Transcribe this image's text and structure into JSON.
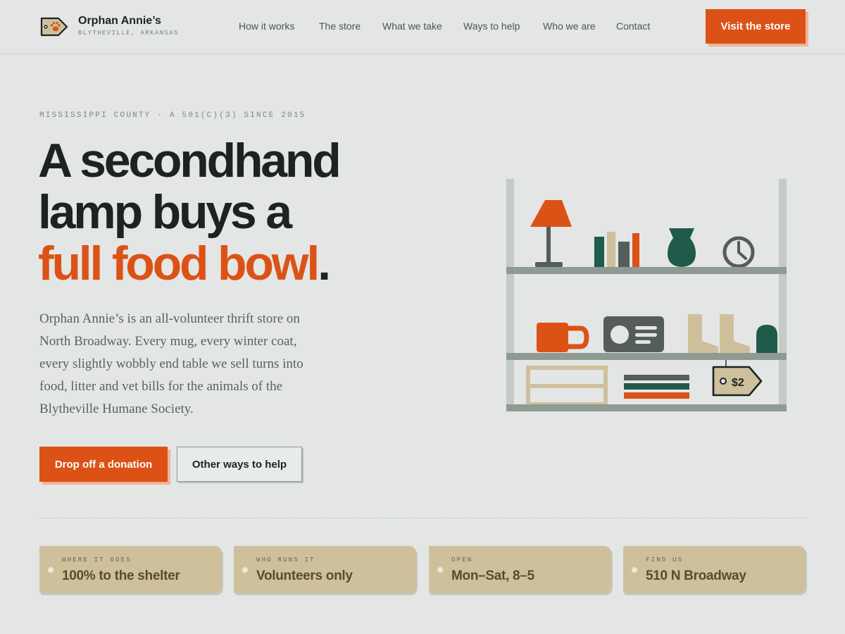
{
  "brand": {
    "name": "Orphan Annie’s",
    "location": "BLYTHEVILLE, ARKANSAS"
  },
  "nav": {
    "items": [
      {
        "label": "How it works"
      },
      {
        "label": "The store"
      },
      {
        "label": "What we take"
      },
      {
        "label": "Ways to help"
      },
      {
        "label": "Who we are"
      },
      {
        "label": "Contact"
      }
    ],
    "cta_label": "Visit the store"
  },
  "hero": {
    "eyebrow": "MISSISSIPPI COUNTY · A 501(C)(3) SINCE 2015",
    "headline_line1": "A secondhand",
    "headline_line2": "lamp buys a",
    "headline_accent": "full food bowl",
    "headline_period": ".",
    "lede": "Orphan Annie’s is an all-volunteer thrift store on North Broadway. Every mug, every winter coat, every slightly wobbly end table we sell turns into food, litter and vet bills for the animals of the Blytheville Humane Society.",
    "primary_button": "Drop off a donation",
    "secondary_button": "Other ways to help"
  },
  "illustration": {
    "price_tag": "$2"
  },
  "facts": [
    {
      "label": "WHERE IT GOES",
      "value": "100% to the shelter"
    },
    {
      "label": "WHO RUNS IT",
      "value": "Volunteers only"
    },
    {
      "label": "OPEN",
      "value": "Mon–Sat, 8–5"
    },
    {
      "label": "FIND US",
      "value": "510 N Broadway"
    }
  ],
  "colors": {
    "background": "#e3e6e5",
    "accent": "#dc5216",
    "ink": "#1c2421",
    "tag": "#cfc09c",
    "green": "#1f5a4a",
    "shelf": "#8e9a93"
  },
  "icons": {
    "logo": "price-tag-paw-icon"
  }
}
